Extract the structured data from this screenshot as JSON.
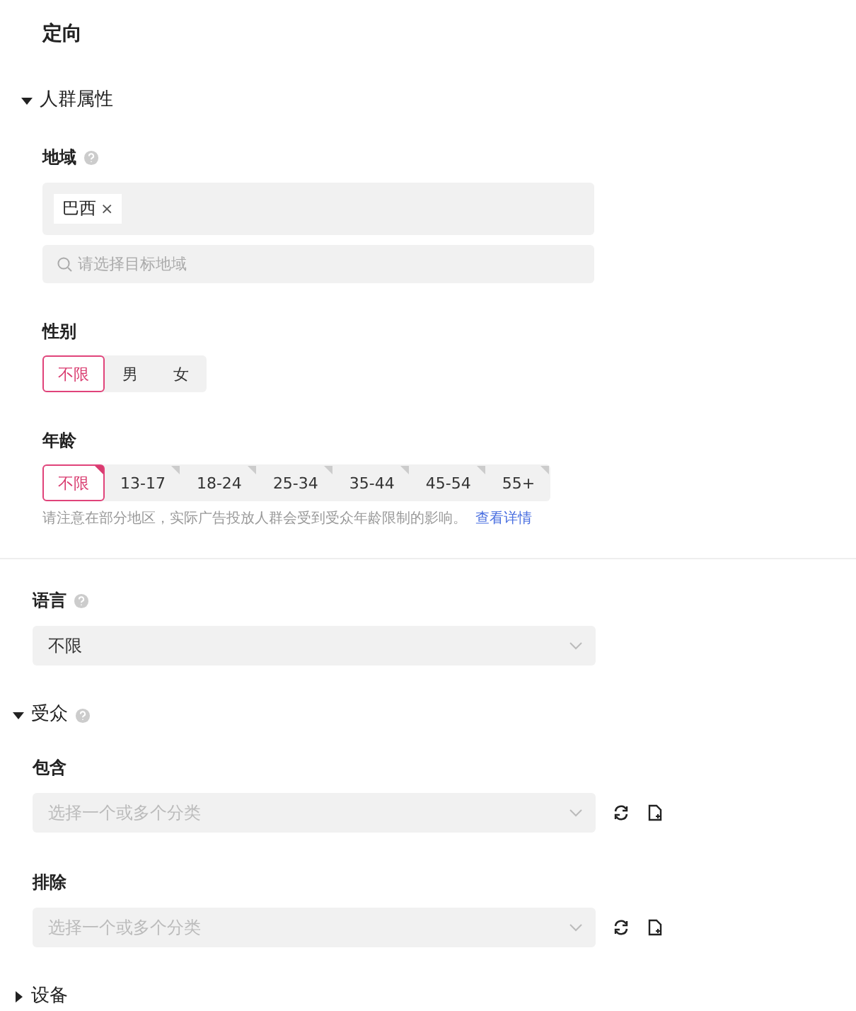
{
  "title": "定向",
  "demographics": {
    "heading": "人群属性",
    "expanded": true,
    "region": {
      "label": "地域",
      "tags": [
        {
          "text": "巴西",
          "remove": "×"
        }
      ],
      "search": {
        "placeholder": "请选择目标地域"
      }
    },
    "gender": {
      "label": "性别",
      "options": [
        {
          "label": "不限",
          "selected": true
        },
        {
          "label": "男",
          "selected": false
        },
        {
          "label": "女",
          "selected": false
        }
      ]
    },
    "age": {
      "label": "年龄",
      "options": [
        {
          "label": "不限",
          "selected": true
        },
        {
          "label": "13-17",
          "selected": false
        },
        {
          "label": "18-24",
          "selected": false
        },
        {
          "label": "25-34",
          "selected": false
        },
        {
          "label": "35-44",
          "selected": false
        },
        {
          "label": "45-54",
          "selected": false
        },
        {
          "label": "55+",
          "selected": false
        }
      ],
      "note": "请注意在部分地区，实际广告投放人群会受到受众年龄限制的影响。",
      "link": "查看详情"
    }
  },
  "language": {
    "label": "语言",
    "value": "不限"
  },
  "audience": {
    "heading": "受众",
    "expanded": true,
    "include": {
      "label": "包含",
      "placeholder": "选择一个或多个分类"
    },
    "exclude": {
      "label": "排除",
      "placeholder": "选择一个或多个分类"
    }
  },
  "device": {
    "heading": "设备",
    "expanded": false
  }
}
